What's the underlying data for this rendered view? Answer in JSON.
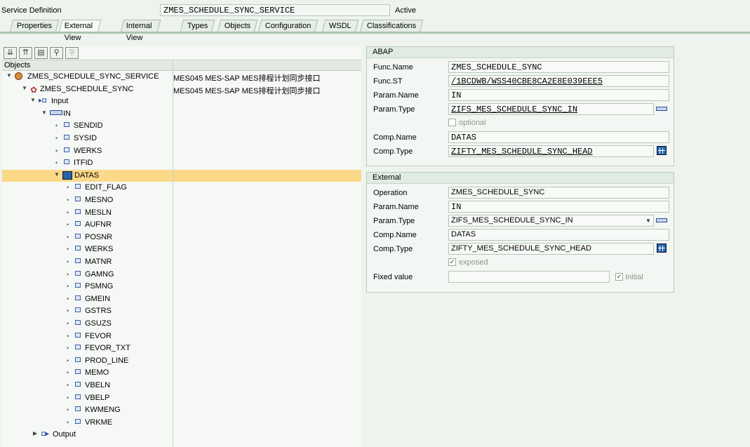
{
  "header": {
    "label": "Service Definition",
    "value": "ZMES_SCHEDULE_SYNC_SERVICE",
    "status": "Active"
  },
  "tabs": [
    "Properties",
    "External View",
    "Internal View",
    "Types",
    "Objects",
    "Configuration",
    "WSDL",
    "Classifications"
  ],
  "active_tab": "External View",
  "tree": {
    "header": "Objects",
    "root": {
      "label": "ZMES_SCHEDULE_SYNC_SERVICE",
      "desc": "MES045 MES-SAP MES排程计划同步接口"
    },
    "operation": {
      "label": "ZMES_SCHEDULE_SYNC",
      "desc": "MES045 MES-SAP MES排程计划同步接口"
    },
    "input": "Input",
    "param": "IN",
    "fields": [
      "SENDID",
      "SYSID",
      "WERKS",
      "ITFID"
    ],
    "table": "DATAS",
    "table_fields": [
      "EDIT_FLAG",
      "MESNO",
      "MESLN",
      "AUFNR",
      "POSNR",
      "WERKS",
      "MATNR",
      "GAMNG",
      "PSMNG",
      "GMEIN",
      "GSTRS",
      "GSUZS",
      "FEVOR",
      "FEVOR_TXT",
      "PROD_LINE",
      "MEMO",
      "VBELN",
      "VBELP",
      "KWMENG",
      "VRKME"
    ],
    "output": "Output"
  },
  "abap": {
    "title": "ABAP",
    "func_name_label": "Func.Name",
    "func_name": "ZMES_SCHEDULE_SYNC",
    "func_st_label": "Func.ST",
    "func_st": "/1BCDWB/WSS40CBE8CA2E8E039EEE5",
    "param_name_label": "Param.Name",
    "param_name": "IN",
    "param_type_label": "Param.Type",
    "param_type": "ZIFS_MES_SCHEDULE_SYNC_IN",
    "optional_label": "optional",
    "comp_name_label": "Comp.Name",
    "comp_name": "DATAS",
    "comp_type_label": "Comp.Type",
    "comp_type": "ZIFTY_MES_SCHEDULE_SYNC_HEAD"
  },
  "external": {
    "title": "External",
    "operation_label": "Operation",
    "operation": "ZMES_SCHEDULE_SYNC",
    "param_name_label": "Param.Name",
    "param_name": "IN",
    "param_type_label": "Param.Type",
    "param_type": "ZIFS_MES_SCHEDULE_SYNC_IN",
    "comp_name_label": "Comp.Name",
    "comp_name": "DATAS",
    "comp_type_label": "Comp.Type",
    "comp_type": "ZIFTY_MES_SCHEDULE_SYNC_HEAD",
    "exposed_label": "exposed",
    "fixed_value_label": "Fixed value",
    "initial_label": "Initial"
  }
}
